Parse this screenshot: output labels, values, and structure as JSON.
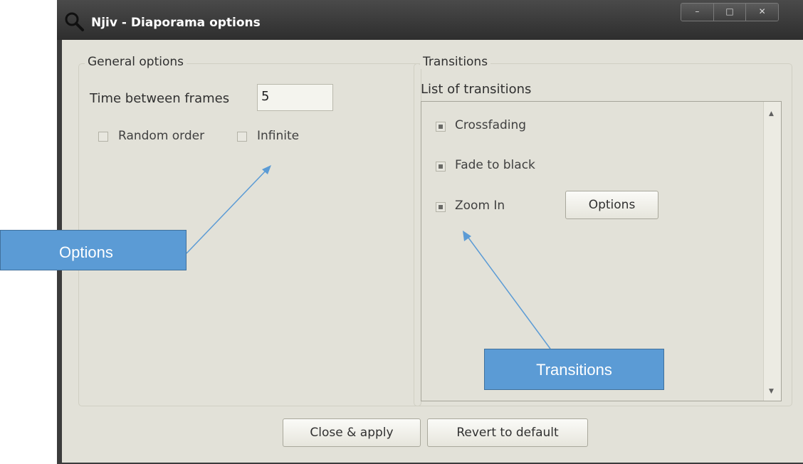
{
  "window": {
    "title": "Njiv - Diaporama options",
    "controls": {
      "minimize": "–",
      "maximize": "□",
      "close": "✕"
    }
  },
  "general": {
    "group_title": "General options",
    "time_label": "Time between frames",
    "time_value": "5",
    "random_label": "Random order",
    "random_checked": false,
    "infinite_label": "Infinite",
    "infinite_checked": false
  },
  "transitions": {
    "group_title": "Transitions",
    "list_label": "List of transitions",
    "items": [
      {
        "label": "Crossfading",
        "checked": true
      },
      {
        "label": "Fade to black",
        "checked": true
      },
      {
        "label": "Zoom In",
        "checked": true
      }
    ],
    "options_button": "Options"
  },
  "footer": {
    "close_apply": "Close & apply",
    "revert": "Revert to default"
  },
  "callouts": {
    "options": "Options",
    "transitions": "Transitions"
  },
  "colors": {
    "callout_fill": "#5b9bd5",
    "callout_border": "#41719c",
    "titlebar": "#2e2e2e",
    "dialog_bg": "#e2e1d8"
  },
  "icons": {
    "title": "magnifier-icon",
    "scroll_up": "scroll-up-arrow-icon",
    "scroll_down": "scroll-down-arrow-icon"
  }
}
